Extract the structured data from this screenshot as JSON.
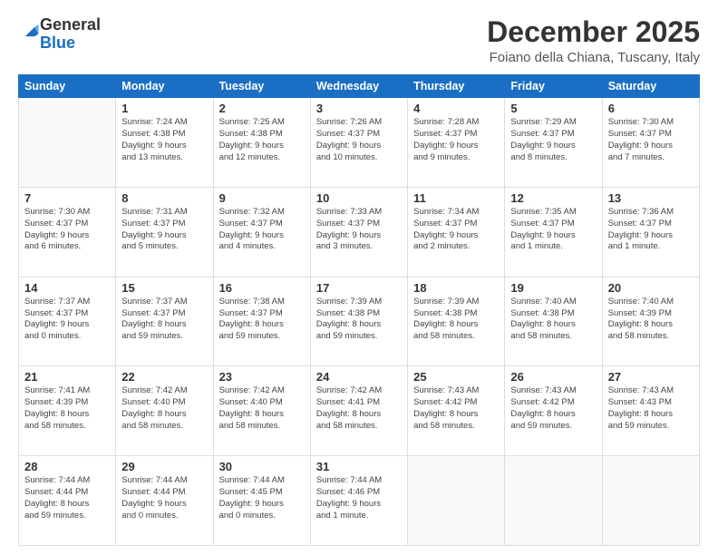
{
  "logo": {
    "general": "General",
    "blue": "Blue"
  },
  "header": {
    "month_year": "December 2025",
    "location": "Foiano della Chiana, Tuscany, Italy"
  },
  "days_of_week": [
    "Sunday",
    "Monday",
    "Tuesday",
    "Wednesday",
    "Thursday",
    "Friday",
    "Saturday"
  ],
  "weeks": [
    [
      {
        "day": "",
        "info": ""
      },
      {
        "day": "1",
        "info": "Sunrise: 7:24 AM\nSunset: 4:38 PM\nDaylight: 9 hours\nand 13 minutes."
      },
      {
        "day": "2",
        "info": "Sunrise: 7:25 AM\nSunset: 4:38 PM\nDaylight: 9 hours\nand 12 minutes."
      },
      {
        "day": "3",
        "info": "Sunrise: 7:26 AM\nSunset: 4:37 PM\nDaylight: 9 hours\nand 10 minutes."
      },
      {
        "day": "4",
        "info": "Sunrise: 7:28 AM\nSunset: 4:37 PM\nDaylight: 9 hours\nand 9 minutes."
      },
      {
        "day": "5",
        "info": "Sunrise: 7:29 AM\nSunset: 4:37 PM\nDaylight: 9 hours\nand 8 minutes."
      },
      {
        "day": "6",
        "info": "Sunrise: 7:30 AM\nSunset: 4:37 PM\nDaylight: 9 hours\nand 7 minutes."
      }
    ],
    [
      {
        "day": "7",
        "info": "Sunrise: 7:30 AM\nSunset: 4:37 PM\nDaylight: 9 hours\nand 6 minutes."
      },
      {
        "day": "8",
        "info": "Sunrise: 7:31 AM\nSunset: 4:37 PM\nDaylight: 9 hours\nand 5 minutes."
      },
      {
        "day": "9",
        "info": "Sunrise: 7:32 AM\nSunset: 4:37 PM\nDaylight: 9 hours\nand 4 minutes."
      },
      {
        "day": "10",
        "info": "Sunrise: 7:33 AM\nSunset: 4:37 PM\nDaylight: 9 hours\nand 3 minutes."
      },
      {
        "day": "11",
        "info": "Sunrise: 7:34 AM\nSunset: 4:37 PM\nDaylight: 9 hours\nand 2 minutes."
      },
      {
        "day": "12",
        "info": "Sunrise: 7:35 AM\nSunset: 4:37 PM\nDaylight: 9 hours\nand 1 minute."
      },
      {
        "day": "13",
        "info": "Sunrise: 7:36 AM\nSunset: 4:37 PM\nDaylight: 9 hours\nand 1 minute."
      }
    ],
    [
      {
        "day": "14",
        "info": "Sunrise: 7:37 AM\nSunset: 4:37 PM\nDaylight: 9 hours\nand 0 minutes."
      },
      {
        "day": "15",
        "info": "Sunrise: 7:37 AM\nSunset: 4:37 PM\nDaylight: 8 hours\nand 59 minutes."
      },
      {
        "day": "16",
        "info": "Sunrise: 7:38 AM\nSunset: 4:37 PM\nDaylight: 8 hours\nand 59 minutes."
      },
      {
        "day": "17",
        "info": "Sunrise: 7:39 AM\nSunset: 4:38 PM\nDaylight: 8 hours\nand 59 minutes."
      },
      {
        "day": "18",
        "info": "Sunrise: 7:39 AM\nSunset: 4:38 PM\nDaylight: 8 hours\nand 58 minutes."
      },
      {
        "day": "19",
        "info": "Sunrise: 7:40 AM\nSunset: 4:38 PM\nDaylight: 8 hours\nand 58 minutes."
      },
      {
        "day": "20",
        "info": "Sunrise: 7:40 AM\nSunset: 4:39 PM\nDaylight: 8 hours\nand 58 minutes."
      }
    ],
    [
      {
        "day": "21",
        "info": "Sunrise: 7:41 AM\nSunset: 4:39 PM\nDaylight: 8 hours\nand 58 minutes."
      },
      {
        "day": "22",
        "info": "Sunrise: 7:42 AM\nSunset: 4:40 PM\nDaylight: 8 hours\nand 58 minutes."
      },
      {
        "day": "23",
        "info": "Sunrise: 7:42 AM\nSunset: 4:40 PM\nDaylight: 8 hours\nand 58 minutes."
      },
      {
        "day": "24",
        "info": "Sunrise: 7:42 AM\nSunset: 4:41 PM\nDaylight: 8 hours\nand 58 minutes."
      },
      {
        "day": "25",
        "info": "Sunrise: 7:43 AM\nSunset: 4:42 PM\nDaylight: 8 hours\nand 58 minutes."
      },
      {
        "day": "26",
        "info": "Sunrise: 7:43 AM\nSunset: 4:42 PM\nDaylight: 8 hours\nand 59 minutes."
      },
      {
        "day": "27",
        "info": "Sunrise: 7:43 AM\nSunset: 4:43 PM\nDaylight: 8 hours\nand 59 minutes."
      }
    ],
    [
      {
        "day": "28",
        "info": "Sunrise: 7:44 AM\nSunset: 4:44 PM\nDaylight: 8 hours\nand 59 minutes."
      },
      {
        "day": "29",
        "info": "Sunrise: 7:44 AM\nSunset: 4:44 PM\nDaylight: 9 hours\nand 0 minutes."
      },
      {
        "day": "30",
        "info": "Sunrise: 7:44 AM\nSunset: 4:45 PM\nDaylight: 9 hours\nand 0 minutes."
      },
      {
        "day": "31",
        "info": "Sunrise: 7:44 AM\nSunset: 4:46 PM\nDaylight: 9 hours\nand 1 minute."
      },
      {
        "day": "",
        "info": ""
      },
      {
        "day": "",
        "info": ""
      },
      {
        "day": "",
        "info": ""
      }
    ]
  ]
}
